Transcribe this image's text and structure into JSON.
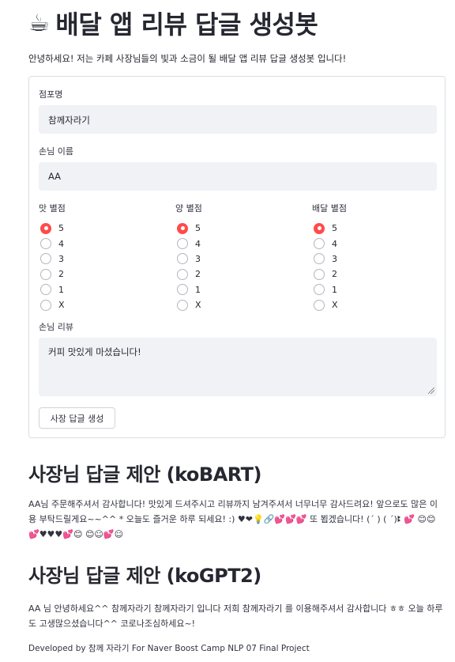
{
  "header": {
    "emoji": "☕",
    "title": "배달 앱 리뷰 답글 생성봇",
    "intro": "안녕하세요! 저는 카페 사장님들의 빛과 소금이 될 배달 앱 리뷰 답글 생성봇 입니다!"
  },
  "form": {
    "store_label": "점포명",
    "store_value": "참께자라기",
    "customer_label": "손님 이름",
    "customer_value": "AA",
    "ratings": [
      {
        "label": "맛 별점",
        "options": [
          "5",
          "4",
          "3",
          "2",
          "1",
          "X"
        ],
        "selected": "5"
      },
      {
        "label": "양 별점",
        "options": [
          "5",
          "4",
          "3",
          "2",
          "1",
          "X"
        ],
        "selected": "5"
      },
      {
        "label": "배달 별점",
        "options": [
          "5",
          "4",
          "3",
          "2",
          "1",
          "X"
        ],
        "selected": "5"
      }
    ],
    "review_label": "손님 리뷰",
    "review_value": "커피 맛있게 마셨습니다!",
    "submit_label": "사장 답글 생성"
  },
  "results": {
    "kobart_heading": "사장님 답글 제안 (koBART)",
    "kobart_reply": "AA님 주문해주셔서 감사합니다! 맛있게 드셔주시고 리뷰까지 남겨주셔서 너무너무 감사드려요! 앞으로도 많은 이용 부탁드릴게요~~^^ * 오늘도 즐거운 하루 되세요! :) ♥❤💡🔗💕💕💕 또 뵙겠습니다! (´ ) ( ´)ꔪ 💕 😊😊💕♥♥♥💕😊 😊☺💕☺",
    "kogpt2_heading": "사장님 답글 제안 (koGPT2)",
    "kogpt2_reply": "AA 님 안녕하세요^^ 참께자라기 참께자라기 입니다 저희 참께자라기 를 이용해주셔서 감사합니다 ㅎㅎ 오늘 하루도 고생많으셨습니다^^ 코로나조심하세요~!"
  },
  "footer": {
    "text": "Developed by 참께 자라기 For Naver Boost Camp NLP 07 Final Project"
  },
  "colors": {
    "accent": "#ff4b4b",
    "input_bg": "#f0f2f6",
    "border": "#dcdde2",
    "text": "#262730"
  }
}
